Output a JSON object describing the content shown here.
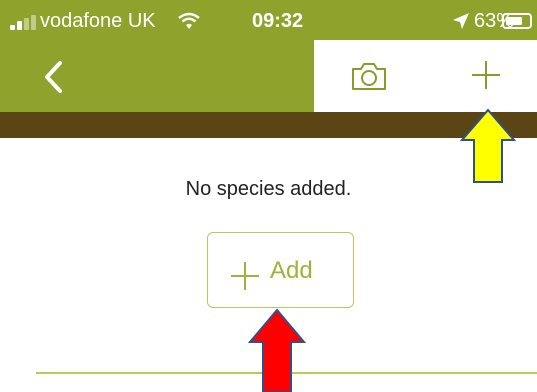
{
  "status_bar": {
    "carrier": "vodafone UK",
    "time": "09:32",
    "battery": "63%",
    "battery_level": 0.63
  },
  "nav": {
    "icons": [
      "back-icon",
      "camera-icon",
      "plus-icon"
    ]
  },
  "content": {
    "empty_message": "No species added.",
    "add_label": "Add"
  },
  "annotations": {
    "arrow_colors": [
      "#ffff00",
      "#ff0000"
    ]
  },
  "colors": {
    "header": "#8fa22b",
    "band": "#5b4515",
    "accent": "#9db33a",
    "border": "#b9ca5a"
  }
}
